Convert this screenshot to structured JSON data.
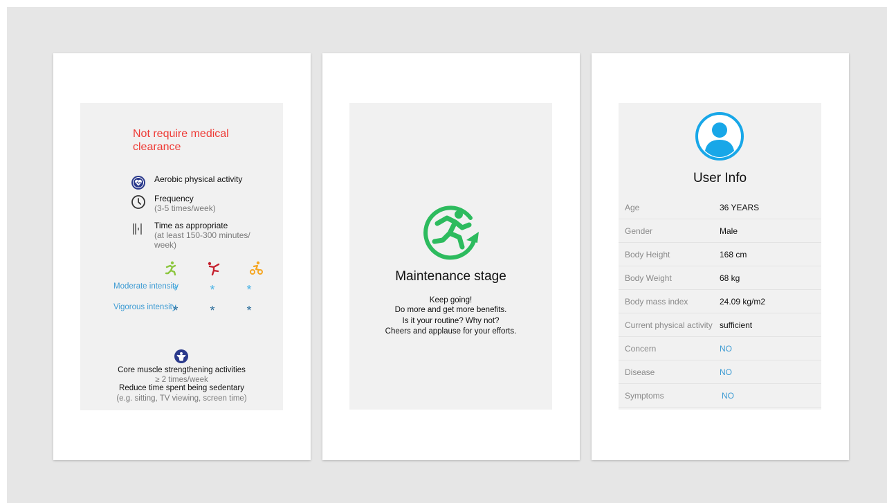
{
  "colors": {
    "background": "#e6e6e6",
    "card": "#ffffff",
    "screen": "#f1f1f1",
    "alert_red": "#ee3a35",
    "intensity_blue": "#3d9bd3",
    "star_light_blue": "#4ab3e6",
    "star_dark_blue": "#2e6f9c",
    "icon_navy": "#2b3a8c",
    "stage_green": "#2dbb5e",
    "avatar_blue": "#18a7e8",
    "activity_green": "#8cc63f",
    "activity_red": "#c5202e",
    "activity_orange": "#f5a623"
  },
  "card1": {
    "title": "Not require medical clearance",
    "aerobic": {
      "icon": "heart-pulse-icon",
      "label": "Aerobic physical activity"
    },
    "frequency": {
      "icon": "clock-icon",
      "label": "Frequency",
      "detail": "(3-5 times/week)"
    },
    "time": {
      "icon": "duration-bars-icon",
      "label": "Time as appropriate",
      "detail": "(at least 150-300 minutes/ week)"
    },
    "activity_icons": [
      "running-icon",
      "dancing-icon",
      "cycling-icon"
    ],
    "intensity": {
      "moderate": "Moderate intensity",
      "vigorous": "Vigorous intensity",
      "star": "*"
    },
    "core": {
      "icon": "strength-icon",
      "title": "Core muscle strengthening activities",
      "frequency": "≥ 2 times/week",
      "sedentary": "Reduce time spent being sedentary",
      "examples": "(e.g. sitting, TV viewing, screen time)"
    }
  },
  "card2": {
    "icon": "maintenance-cycle-icon",
    "title": "Maintenance stage",
    "lines": [
      "Keep going!",
      "Do more and get more benefits.",
      "Is it your routine? Why not?",
      "Cheers and applause for your efforts."
    ]
  },
  "card3": {
    "icon": "user-avatar-icon",
    "title": "User Info",
    "rows": [
      {
        "label": "Age",
        "value": "36 YEARS"
      },
      {
        "label": "Gender",
        "value": "Male"
      },
      {
        "label": "Body Height",
        "value": "168 cm"
      },
      {
        "label": "Body Weight",
        "value": "68 kg"
      },
      {
        "label": "Body mass index",
        "value": "24.09 kg/m2"
      },
      {
        "label": "Current physical activity",
        "value": "sufficient"
      },
      {
        "label": "Concern",
        "value": "NO"
      },
      {
        "label": "Disease",
        "value": "NO"
      },
      {
        "label": "Symptoms",
        "value": "NO"
      }
    ]
  }
}
